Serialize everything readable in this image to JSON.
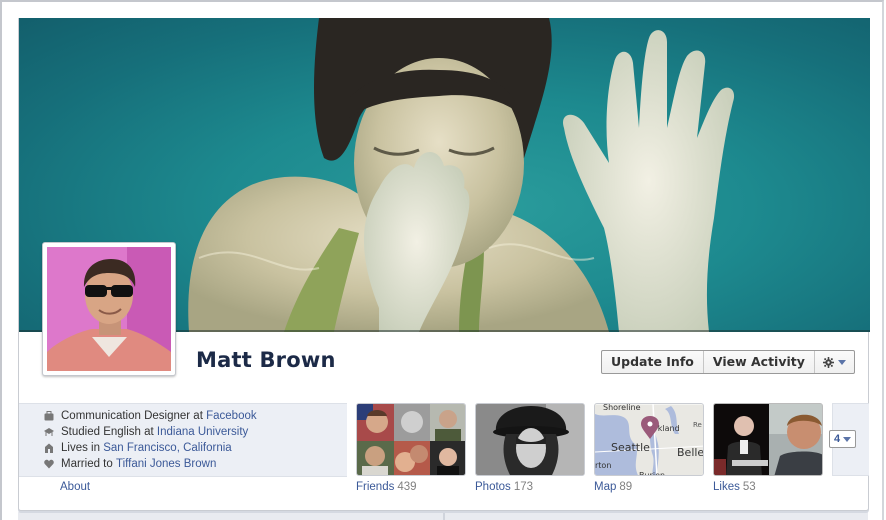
{
  "profile": {
    "name": "Matt Brown"
  },
  "colors": {
    "link": "#3b5998",
    "name": "#1c2a47",
    "panel_bg": "#eceff5",
    "cover_water": "#1d8a8f"
  },
  "actions": {
    "update_info": "Update Info",
    "view_activity": "View Activity",
    "settings_icon": "gear-icon"
  },
  "info": [
    {
      "icon": "briefcase-icon",
      "prefix": "Communication Designer at ",
      "link": "Facebook"
    },
    {
      "icon": "graduation-icon",
      "prefix": "Studied English at ",
      "link": "Indiana University"
    },
    {
      "icon": "house-icon",
      "prefix": "Lives in ",
      "link": "San Francisco, California"
    },
    {
      "icon": "heart-icon",
      "prefix": "Married to ",
      "link": "Tiffani Jones Brown"
    }
  ],
  "about_label": "About",
  "sections": [
    {
      "label": "Friends",
      "count": "439"
    },
    {
      "label": "Photos",
      "count": "173"
    },
    {
      "label": "Map",
      "count": "89"
    },
    {
      "label": "Likes",
      "count": "53"
    }
  ],
  "map_labels": {
    "shoreline": "Shoreline",
    "kirkland": "Kirkland",
    "redmond": "Re",
    "seattle": "Seattle",
    "bellevue": "Belle",
    "burton": "rton",
    "burien": "Burien"
  },
  "more": {
    "count": "4"
  }
}
